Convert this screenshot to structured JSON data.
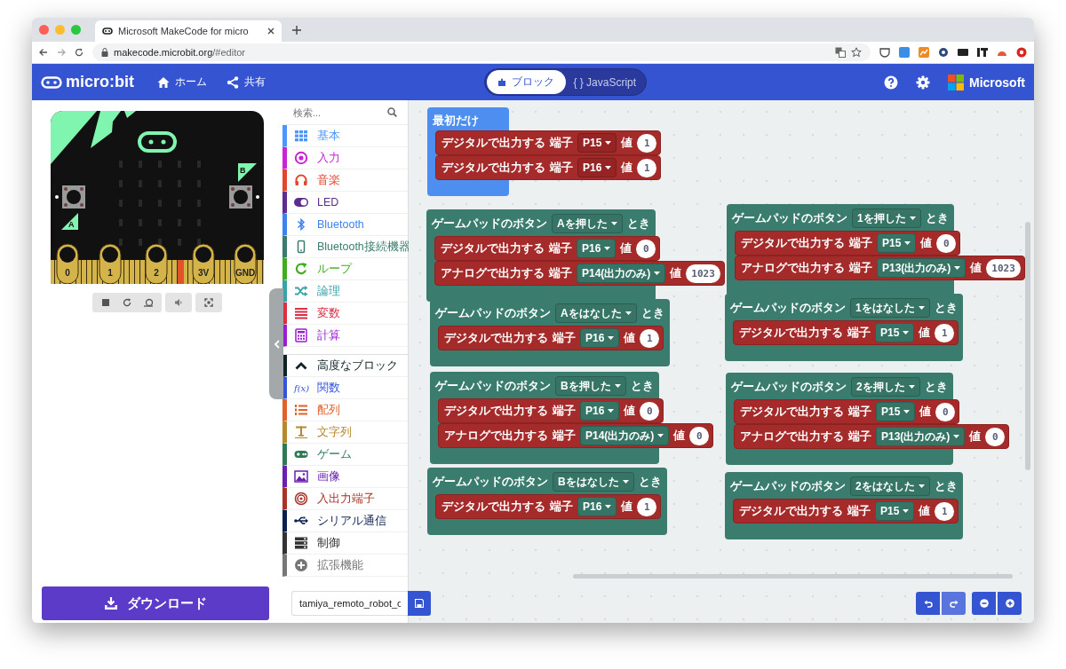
{
  "browser": {
    "tab_title": "Microsoft MakeCode for micro",
    "url_host": "makecode.microbit.org",
    "url_path": "/#editor"
  },
  "header": {
    "logo": "micro:bit",
    "nav": [
      {
        "kind": "home",
        "label": "ホーム"
      },
      {
        "kind": "share",
        "label": "共有"
      }
    ],
    "mode_tabs": [
      {
        "kind": "blocks",
        "label": "ブロック",
        "selected": true
      },
      {
        "kind": "code",
        "label": "{ } JavaScript",
        "selected": false
      }
    ],
    "brand": "Microsoft"
  },
  "simulator": {
    "buttons": [
      "A",
      "B"
    ],
    "pins": [
      "0",
      "1",
      "2",
      "3V",
      "GND"
    ]
  },
  "toolbox": {
    "search": {
      "placeholder": "検索..."
    },
    "categories": [
      {
        "kind": "grid",
        "label": "基本",
        "color": "#4c97ff"
      },
      {
        "kind": "target",
        "label": "入力",
        "color": "#c724d6"
      },
      {
        "kind": "headphones",
        "label": "音楽",
        "color": "#e2462f"
      },
      {
        "kind": "toggle",
        "label": "LED",
        "color": "#5c2d91"
      },
      {
        "kind": "bluetooth",
        "label": "Bluetooth",
        "color": "#3c83ee"
      },
      {
        "kind": "phone",
        "label": "Bluetooth接続機器",
        "color": "#3a7d6f"
      },
      {
        "kind": "loop",
        "label": "ループ",
        "color": "#40ad21"
      },
      {
        "kind": "shuffle",
        "label": "論理",
        "color": "#3aa3a8"
      },
      {
        "kind": "bars",
        "label": "変数",
        "color": "#dc2d42"
      },
      {
        "kind": "calculator",
        "label": "計算",
        "color": "#9a1ed1"
      }
    ],
    "advanced": [
      {
        "kind": "caret",
        "label": "高度なブロック",
        "color": "#0e2326"
      },
      {
        "kind": "function",
        "label": "関数",
        "color": "#3455db",
        "icon_text": "f(x)"
      },
      {
        "kind": "list",
        "label": "配列",
        "color": "#e0612c"
      },
      {
        "kind": "text",
        "label": "文字列",
        "color": "#b8892c"
      },
      {
        "kind": "gamepad",
        "label": "ゲーム",
        "color": "#2d7a55"
      },
      {
        "kind": "image",
        "label": "画像",
        "color": "#6a1fb0"
      },
      {
        "kind": "rings",
        "label": "入出力端子",
        "color": "#a83228"
      },
      {
        "kind": "usb",
        "label": "シリアル通信",
        "color": "#0b1f4f"
      },
      {
        "kind": "server",
        "label": "制御",
        "color": "#333333"
      },
      {
        "kind": "plus",
        "label": "拡張機能",
        "color": "#777777"
      }
    ]
  },
  "blocks": [
    {
      "kind": "start",
      "label": "最初だけ",
      "statements": [
        {
          "label": "デジタルで出力する",
          "pin_label": "端子",
          "pin": "P15",
          "value_label": "値",
          "value": "1"
        },
        {
          "label": "デジタルで出力する",
          "pin_label": "端子",
          "pin": "P16",
          "value_label": "値",
          "value": "1"
        }
      ]
    },
    {
      "kind": "event",
      "label": "ゲームパッドのボタン",
      "option": "Aを押した",
      "suffix": "とき",
      "statements": [
        {
          "label": "デジタルで出力する",
          "pin_label": "端子",
          "pin": "P16",
          "value_label": "値",
          "value": "0"
        },
        {
          "label": "アナログで出力する",
          "pin_label": "端子",
          "pin": "P14(出力のみ)",
          "value_label": "値",
          "value": "1023"
        }
      ]
    },
    {
      "kind": "event",
      "label": "ゲームパッドのボタン",
      "option": "Aをはなした",
      "suffix": "とき",
      "statements": [
        {
          "label": "デジタルで出力する",
          "pin_label": "端子",
          "pin": "P16",
          "value_label": "値",
          "value": "1"
        }
      ]
    },
    {
      "kind": "event",
      "label": "ゲームパッドのボタン",
      "option": "Bを押した",
      "suffix": "とき",
      "statements": [
        {
          "label": "デジタルで出力する",
          "pin_label": "端子",
          "pin": "P16",
          "value_label": "値",
          "value": "0"
        },
        {
          "label": "アナログで出力する",
          "pin_label": "端子",
          "pin": "P14(出力のみ)",
          "value_label": "値",
          "value": "0"
        }
      ]
    },
    {
      "kind": "event",
      "label": "ゲームパッドのボタン",
      "option": "Bをはなした",
      "suffix": "とき",
      "statements": [
        {
          "label": "デジタルで出力する",
          "pin_label": "端子",
          "pin": "P16",
          "value_label": "値",
          "value": "1"
        }
      ]
    },
    {
      "kind": "event",
      "label": "ゲームパッドのボタン",
      "option": "1を押した",
      "suffix": "とき",
      "statements": [
        {
          "label": "デジタルで出力する",
          "pin_label": "端子",
          "pin": "P15",
          "value_label": "値",
          "value": "0"
        },
        {
          "label": "アナログで出力する",
          "pin_label": "端子",
          "pin": "P13(出力のみ)",
          "value_label": "値",
          "value": "1023"
        }
      ]
    },
    {
      "kind": "event",
      "label": "ゲームパッドのボタン",
      "option": "1をはなした",
      "suffix": "とき",
      "statements": [
        {
          "label": "デジタルで出力する",
          "pin_label": "端子",
          "pin": "P15",
          "value_label": "値",
          "value": "1"
        }
      ]
    },
    {
      "kind": "event",
      "label": "ゲームパッドのボタン",
      "option": "2を押した",
      "suffix": "とき",
      "statements": [
        {
          "label": "デジタルで出力する",
          "pin_label": "端子",
          "pin": "P15",
          "value_label": "値",
          "value": "0"
        },
        {
          "label": "アナログで出力する",
          "pin_label": "端子",
          "pin": "P13(出力のみ)",
          "value_label": "値",
          "value": "0"
        }
      ]
    },
    {
      "kind": "event",
      "label": "ゲームパッドのボタン",
      "option": "2をはなした",
      "suffix": "とき",
      "statements": [
        {
          "label": "デジタルで出力する",
          "pin_label": "端子",
          "pin": "P15",
          "value_label": "値",
          "value": "1"
        }
      ]
    }
  ],
  "bottom_bar": {
    "download": "ダウンロード",
    "project_name": "tamiya_remoto_robot_c"
  }
}
